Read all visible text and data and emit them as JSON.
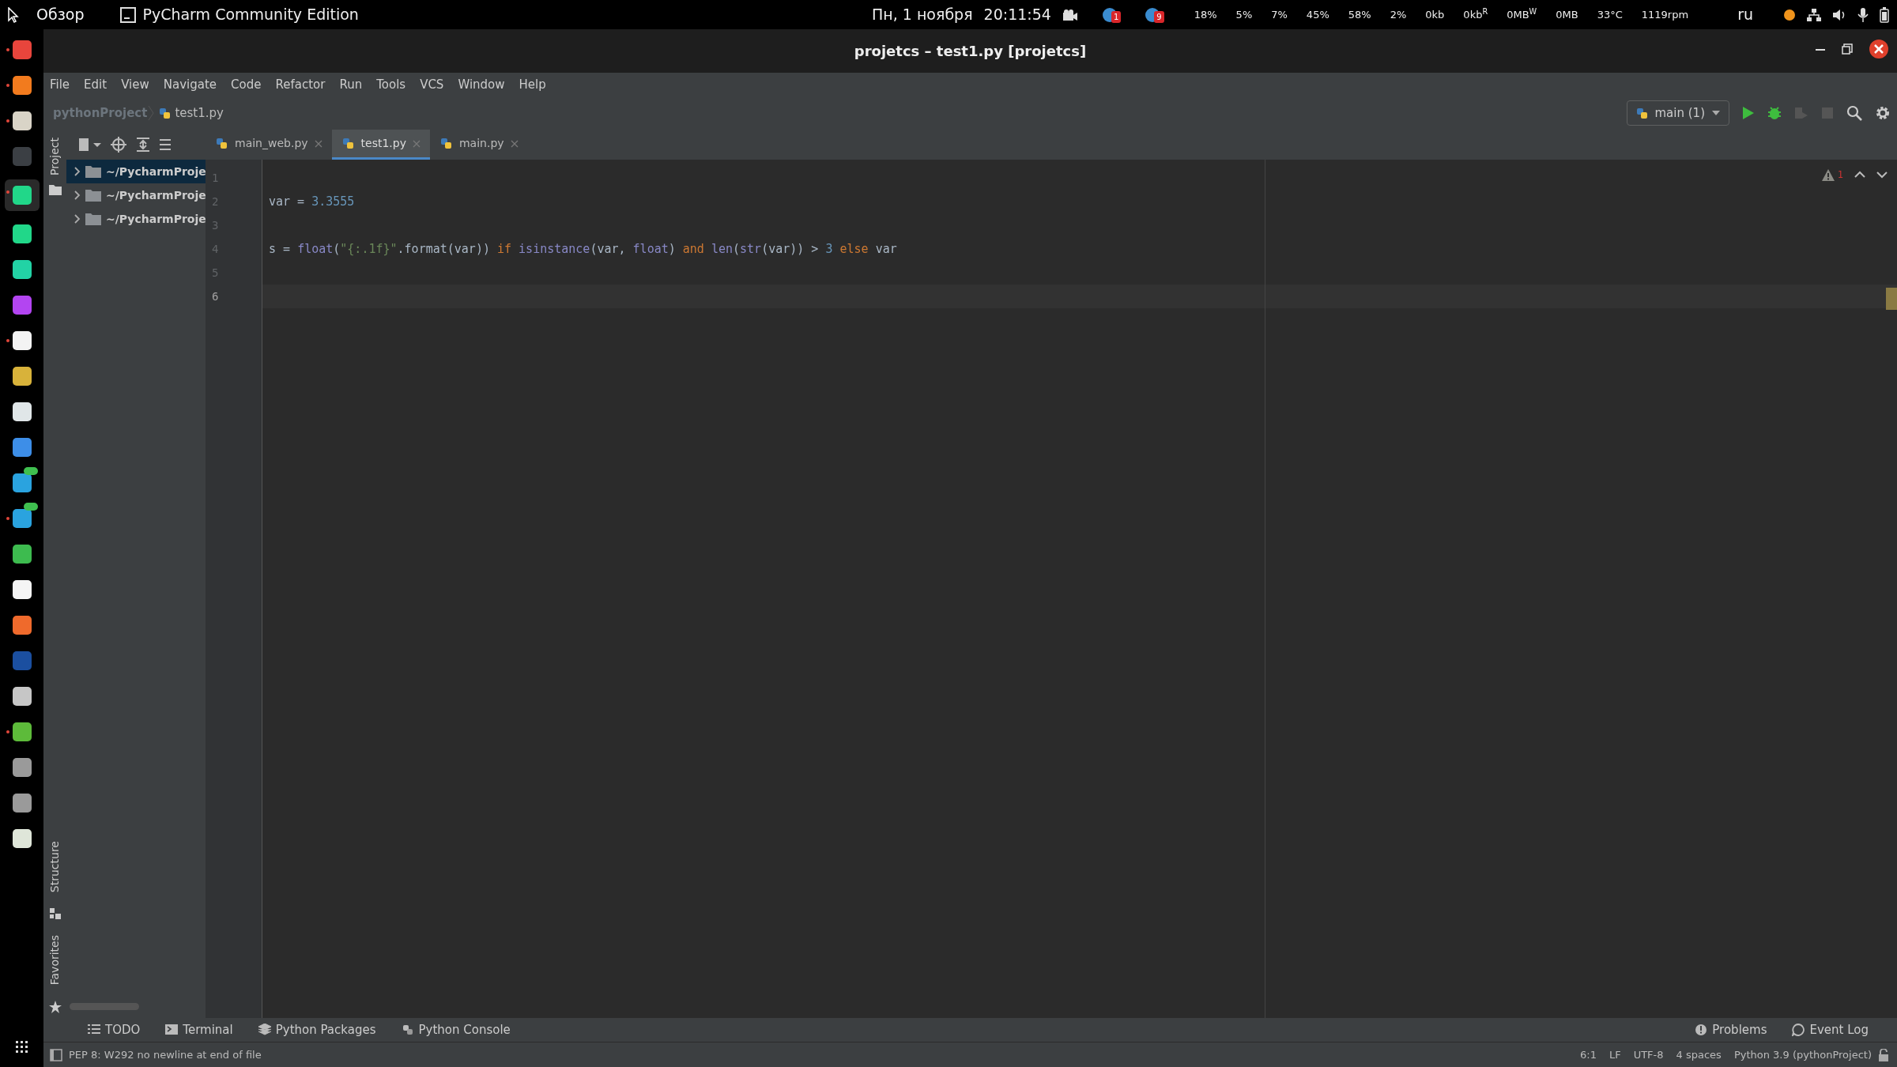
{
  "top_bar": {
    "activities": "Обзор",
    "app": "PyCharm Community Edition",
    "date": "Пн, 1 ноября",
    "time": "20:11:54",
    "tray_badges": [
      "1",
      "9"
    ],
    "stats": [
      "18%",
      "5%",
      "7%",
      "45%",
      "58%",
      "2%",
      "0kb",
      "0kb$^{R}$",
      "0MB$^{W}$",
      "0MB",
      "33°C",
      "1119rpm"
    ],
    "keyboard": "ru"
  },
  "dock": [
    {
      "color": "#e8453c",
      "running": true,
      "selected": false,
      "badge": false
    },
    {
      "color": "#f27b1e",
      "running": true,
      "selected": false,
      "badge": false
    },
    {
      "color": "#d9d4c7",
      "running": true,
      "selected": false,
      "badge": false
    },
    {
      "color": "#3b3f44",
      "running": false,
      "selected": false,
      "badge": false
    },
    {
      "color": "#21d789",
      "running": true,
      "selected": true,
      "badge": false
    },
    {
      "color": "#21d789",
      "running": false,
      "selected": false,
      "badge": false
    },
    {
      "color": "#22d3a5",
      "running": false,
      "selected": false,
      "badge": false
    },
    {
      "color": "#b345f1",
      "running": false,
      "selected": false,
      "badge": false
    },
    {
      "color": "#f3f3f3",
      "running": true,
      "selected": false,
      "badge": false
    },
    {
      "color": "#d8b23a",
      "running": false,
      "selected": false,
      "badge": false
    },
    {
      "color": "#e0e6e8",
      "running": false,
      "selected": false,
      "badge": false
    },
    {
      "color": "#3d8ee8",
      "running": false,
      "selected": false,
      "badge": false
    },
    {
      "color": "#2aa3df",
      "running": false,
      "selected": false,
      "badge": true
    },
    {
      "color": "#2aa3df",
      "running": true,
      "selected": false,
      "badge": true
    },
    {
      "color": "#3dbb4f",
      "running": false,
      "selected": false,
      "badge": false
    },
    {
      "color": "#f5f5f5",
      "running": false,
      "selected": false,
      "badge": false
    },
    {
      "color": "#ef6a2c",
      "running": false,
      "selected": false,
      "badge": false
    },
    {
      "color": "#1b4fa0",
      "running": false,
      "selected": false,
      "badge": false
    },
    {
      "color": "#c6c6c6",
      "running": false,
      "selected": false,
      "badge": false
    },
    {
      "color": "#5dbb3a",
      "running": true,
      "selected": false,
      "badge": false
    },
    {
      "color": "#9a9a9a",
      "running": false,
      "selected": false,
      "badge": false
    },
    {
      "color": "#9a9a9a",
      "running": false,
      "selected": false,
      "badge": false
    },
    {
      "color": "#dfe6d9",
      "running": false,
      "selected": false,
      "badge": false
    }
  ],
  "window": {
    "title": "projetcs – test1.py [projetcs]"
  },
  "menu": [
    "File",
    "Edit",
    "View",
    "Navigate",
    "Code",
    "Refactor",
    "Run",
    "Tools",
    "VCS",
    "Window",
    "Help"
  ],
  "breadcrumb": [
    "pythonProject",
    "test1.py"
  ],
  "run_config": "main (1)",
  "side_tabs": {
    "top": [
      "Project"
    ],
    "bottom": [
      "Structure",
      "Favorites"
    ]
  },
  "project_tree": [
    {
      "label": "~/PycharmProje",
      "expanded": false,
      "selected": true
    },
    {
      "label": "~/PycharmProje",
      "expanded": false,
      "selected": false
    },
    {
      "label": "~/PycharmProje",
      "expanded": false,
      "selected": false
    }
  ],
  "tabs": [
    {
      "label": "main_web.py",
      "selected": false
    },
    {
      "label": "test1.py",
      "selected": true
    },
    {
      "label": "main.py",
      "selected": false
    }
  ],
  "editor": {
    "warnings": "1",
    "lines": [
      {
        "number": "1",
        "current": false
      },
      {
        "number": "2",
        "current": false,
        "tokens": [
          {
            "text": "var = ",
            "kind": "plain"
          },
          {
            "text": "3.3555",
            "kind": "number"
          }
        ]
      },
      {
        "number": "3",
        "current": false
      },
      {
        "number": "4",
        "current": false,
        "tokens": [
          {
            "text": "s = ",
            "kind": "plain"
          },
          {
            "text": "float",
            "kind": "builtin"
          },
          {
            "text": "(",
            "kind": "plain"
          },
          {
            "text": "\"{:.1f}\"",
            "kind": "string"
          },
          {
            "text": ".format(var)) ",
            "kind": "plain"
          },
          {
            "text": "if",
            "kind": "keyword"
          },
          {
            "text": " isinstance",
            "kind": "builtin"
          },
          {
            "text": "(var, ",
            "kind": "plain"
          },
          {
            "text": "float",
            "kind": "builtin"
          },
          {
            "text": ") ",
            "kind": "plain"
          },
          {
            "text": "and",
            "kind": "keyword"
          },
          {
            "text": " len",
            "kind": "builtin"
          },
          {
            "text": "(",
            "kind": "plain"
          },
          {
            "text": "str",
            "kind": "builtin"
          },
          {
            "text": "(var)) > ",
            "kind": "plain"
          },
          {
            "text": "3",
            "kind": "number"
          },
          {
            "text": " else",
            "kind": "keyword"
          },
          {
            "text": " var",
            "kind": "plain"
          }
        ]
      },
      {
        "number": "5",
        "current": false
      },
      {
        "number": "6",
        "current": true
      }
    ]
  },
  "tool_windows": {
    "left": [
      {
        "label": "TODO",
        "kind": "list"
      },
      {
        "label": "Terminal",
        "kind": "terminal"
      },
      {
        "label": "Python Packages",
        "kind": "packages"
      },
      {
        "label": "Python Console",
        "kind": "console"
      }
    ],
    "right": [
      {
        "label": "Problems",
        "kind": "problems"
      },
      {
        "label": "Event Log",
        "kind": "log"
      }
    ]
  },
  "status_bar": {
    "message": "PEP 8: W292 no newline at end of file",
    "items": [
      "6:1",
      "LF",
      "UTF-8",
      "4 spaces",
      "Python 3.9 (pythonProject)"
    ]
  }
}
